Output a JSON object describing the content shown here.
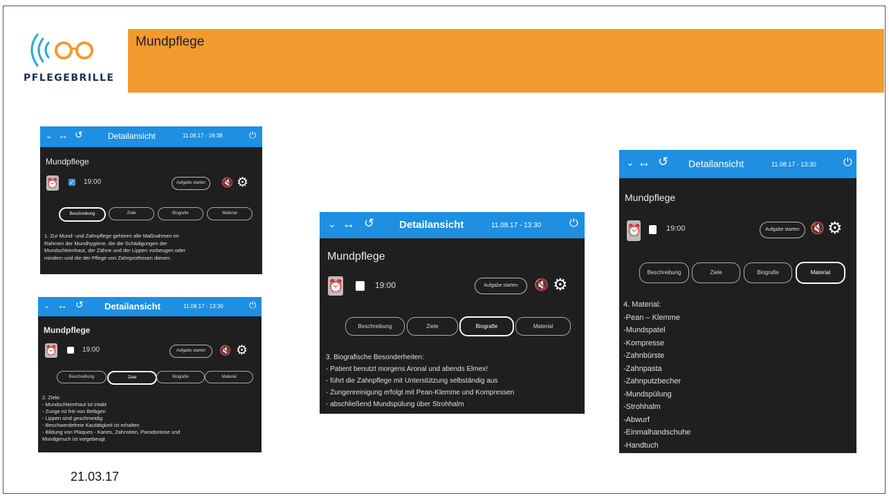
{
  "slide": {
    "brand": "PFLEGEBRILLE",
    "title": "Mundpflege",
    "date": "21.03.17",
    "colors": {
      "banner": "#f39a2f",
      "topbar": "#1e8fe1",
      "panel": "#1f1f1f"
    }
  },
  "panels": [
    {
      "header_title": "Detailansicht",
      "header_time": "11.08.17 - 16:38",
      "task_title": "Mundpflege",
      "time": "19:00",
      "checked": true,
      "start_label": "Aufgabe starten",
      "tabs": [
        "Beschreibung",
        "Ziele",
        "Biografie",
        "Material"
      ],
      "active_tab": 0,
      "body": "1. Zur Mund- und Zahnpflege gehören alle Maßnahmen im\nRahmen der Mundhygiene, die die Schädigungen der\nMundschleimhaut, der Zähne und der Lippen vorbeugen oder\nmindern und die der Pflege von Zahnprothesen dienen."
    },
    {
      "header_title": "Detailansicht",
      "header_time": "11.08.17 - 13:30",
      "task_title": "Mundpflege",
      "time": "19:00",
      "checked": false,
      "start_label": "Aufgabe starten",
      "tabs": [
        "Beschreibung",
        "Ziele",
        "Biografie",
        "Material"
      ],
      "active_tab": 1,
      "body": "2. Ziele:\n- Mundschleimhaut ist intakt\n- Zunge ist frei von Belägen\n- Lippen sind geschmeidig\n- Beschwerdefreie Kautätigkeit ist erhalten\n- Bildung von Plaques - Karies, Zahnstein, Parodontose und\nMundgeruch ist vorgebeugt"
    },
    {
      "header_title": "Detailansicht",
      "header_time": "11.08.17 - 13:30",
      "task_title": "Mundpflege",
      "time": "19:00",
      "checked": false,
      "start_label": "Aufgabe starten",
      "tabs": [
        "Beschreibung",
        "Ziele",
        "Biografie",
        "Material"
      ],
      "active_tab": 2,
      "body": "3. Biografische Besonderheiten:\n- Patient benutzt morgens Aronal und abends Elmex!\n- führt die Zahnpflege mit Unterstützung selbständig aus\n- Zungenreinigung erfolgt mit Pean-Klemme und Kompressen\n- abschließend Mundspülung über Strohhalm"
    },
    {
      "header_title": "Detailansicht",
      "header_time": "11.08.17 - 13:30",
      "task_title": "Mundpflege",
      "time": "19:00",
      "checked": false,
      "start_label": "Aufgabe starten",
      "tabs": [
        "Beschreibung",
        "Ziele",
        "Biografie",
        "Material"
      ],
      "active_tab": 3,
      "body": "4. Material:\n-Pean – Klemme\n-Mundspatel\n-Kompresse\n-Zahnbürste\n-Zahnpasta\n-Zahnputzbecher\n-Mundspülung\n-Strohhalm\n-Abwurf\n-Einmalhandschuhe\n-Handtuch"
    }
  ]
}
